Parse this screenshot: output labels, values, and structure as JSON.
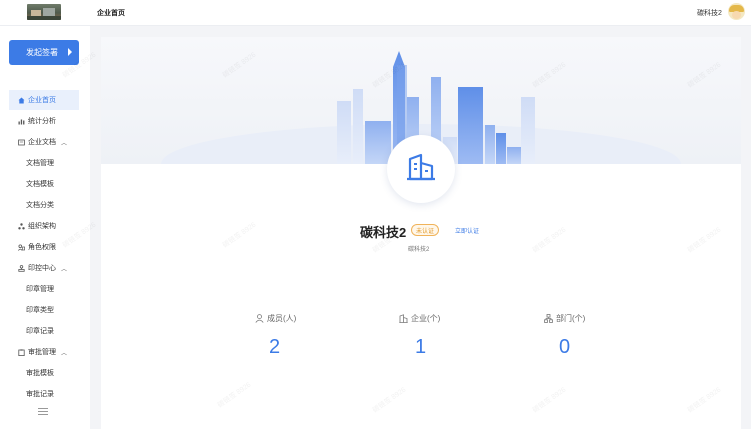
{
  "header": {
    "breadcrumb": "企业首页",
    "user_name": "碳科技2"
  },
  "sidebar": {
    "start_button": "发起签署",
    "items": [
      {
        "label": "企业首页",
        "icon": "home-icon",
        "active": true
      },
      {
        "label": "统计分析",
        "icon": "chart-icon"
      },
      {
        "label": "企业文档",
        "icon": "document-icon",
        "expandable": true
      },
      {
        "label": "文档管理",
        "sub": true
      },
      {
        "label": "文档模板",
        "sub": true
      },
      {
        "label": "文档分类",
        "sub": true
      },
      {
        "label": "组织架构",
        "icon": "org-icon"
      },
      {
        "label": "角色权限",
        "icon": "role-icon"
      },
      {
        "label": "印控中心",
        "icon": "seal-icon",
        "expandable": true
      },
      {
        "label": "印章管理",
        "sub": true
      },
      {
        "label": "印章类型",
        "sub": true
      },
      {
        "label": "印章记录",
        "sub": true
      },
      {
        "label": "审批管理",
        "icon": "approval-icon",
        "expandable": true
      },
      {
        "label": "审批模板",
        "sub": true
      },
      {
        "label": "审批记录",
        "sub": true
      }
    ]
  },
  "company": {
    "name": "碳科技2",
    "badge": "未认证",
    "verify_link": "立即认证",
    "subtitle": "碳科技2"
  },
  "stats": [
    {
      "label": "成员(人)",
      "value": "2",
      "icon": "user-icon"
    },
    {
      "label": "企业(个)",
      "value": "1",
      "icon": "building-icon"
    },
    {
      "label": "部门(个)",
      "value": "0",
      "icon": "department-icon"
    }
  ],
  "watermark_text": "碳链签 8926",
  "colors": {
    "accent": "#3c7be6",
    "badge": "#e39a2a"
  }
}
